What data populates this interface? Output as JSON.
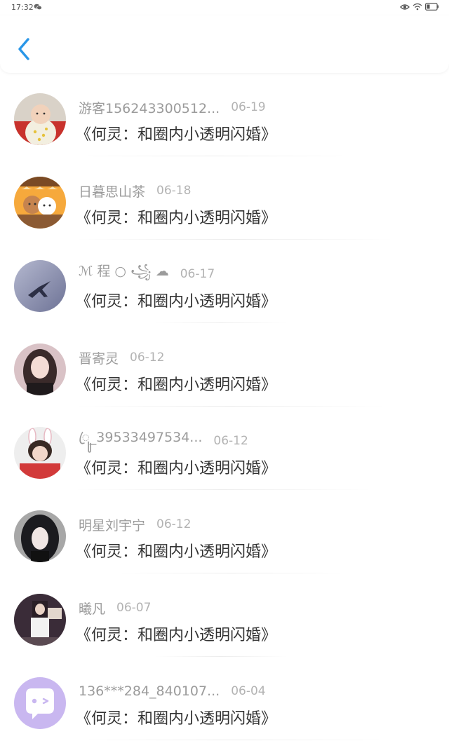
{
  "status": {
    "time": "17:32"
  },
  "colors": {
    "accent": "#2a97e8",
    "name": "#9b9b9b",
    "date": "#b3b3b3",
    "title": "#333333"
  },
  "items": [
    {
      "name": "游客156243300512...",
      "date": "06-19",
      "title": "《何灵：和圈内小透明闪婚》",
      "avatar": "baby-photo"
    },
    {
      "name": "日暮思山茶",
      "date": "06-18",
      "title": "《何灵：和圈内小透明闪婚》",
      "avatar": "cartoon-bears"
    },
    {
      "name": "ℳ 程 ○ ꧁ ☁ ",
      "date": "06-17",
      "title": "《何灵：和圈内小透明闪婚》",
      "avatar": "airplane-sky"
    },
    {
      "name": "晋寄灵",
      "date": "06-12",
      "title": "《何灵：和圈内小透明闪婚》",
      "avatar": "girl-portrait"
    },
    {
      "name": "ꦿꦸ_39533497534...",
      "date": "06-12",
      "title": "《何灵：和圈内小透明闪婚》",
      "avatar": "bunny-ears-girl"
    },
    {
      "name": "明星刘宇宁",
      "date": "06-12",
      "title": "《何灵：和圈内小透明闪婚》",
      "avatar": "hooded-man"
    },
    {
      "name": "曦凡",
      "date": "06-07",
      "title": "《何灵：和圈内小透明闪婚》",
      "avatar": "mirror-selfie"
    },
    {
      "name": "136***284_840107...",
      "date": "06-04",
      "title": "《何灵：和圈内小透明闪婚》",
      "avatar": "chat-bubble-default"
    }
  ]
}
